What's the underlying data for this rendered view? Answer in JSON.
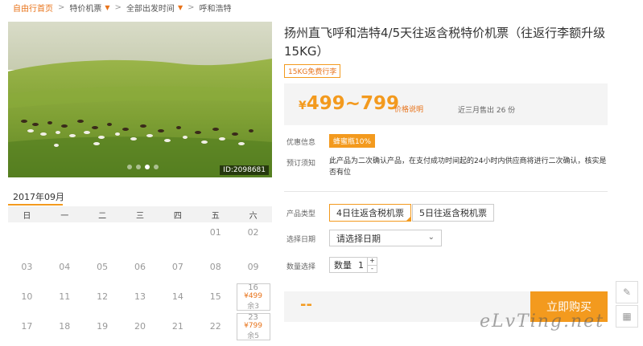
{
  "breadcrumb": {
    "home": "自由行首页",
    "items": [
      "特价机票",
      "全部出发时间",
      "呼和浩特"
    ]
  },
  "photo": {
    "image_id": "ID:2098681",
    "slide_count": 4,
    "active_slide": 2
  },
  "calendar": {
    "month": "2017年09月",
    "weekdays": [
      "日",
      "一",
      "二",
      "三",
      "四",
      "五",
      "六"
    ],
    "rows": [
      [
        "",
        "",
        "",
        "",
        "",
        "01",
        "02"
      ],
      [
        "03",
        "04",
        "05",
        "06",
        "07",
        "08",
        "09"
      ],
      [
        "10",
        "11",
        "12",
        "13",
        "14",
        "15",
        {
          "day": "16",
          "price": "¥499",
          "remain": "余3"
        }
      ],
      [
        "17",
        "18",
        "19",
        "20",
        "21",
        "22",
        {
          "day": "23",
          "price": "¥799",
          "remain": "余5"
        }
      ]
    ]
  },
  "product": {
    "title": "扬州直飞呼和浩特4/5天往返含税特价机票（往返行李额升级15KG）",
    "tag": "15KG免费行李"
  },
  "price": {
    "currency": "¥",
    "range": "499~799",
    "explain_link": "价格说明",
    "sold": "近三月售出 26 份"
  },
  "info": {
    "discount_label": "优惠信息",
    "discount_badge": "蜂蜜瓶10%",
    "notice_label": "预订须知",
    "notice_text": "此产品为二次确认产品，在支付成功时间起的24小时内供应商将进行二次确认，核实是否有位"
  },
  "options": {
    "type_label": "产品类型",
    "types": [
      "4日往返含税机票",
      "5日往返含税机票"
    ],
    "selected_type": 0,
    "date_label": "选择日期",
    "date_placeholder": "请选择日期",
    "qty_label": "数量选择",
    "qty_prefix": "数量",
    "qty_value": "1",
    "qty_plus": "+",
    "qty_minus": "-"
  },
  "buy": {
    "total": "--",
    "button": "立即购买"
  },
  "watermark": "eLvTing.net",
  "colors": {
    "accent": "#f39a1e",
    "accent_dark": "#e8731a"
  }
}
